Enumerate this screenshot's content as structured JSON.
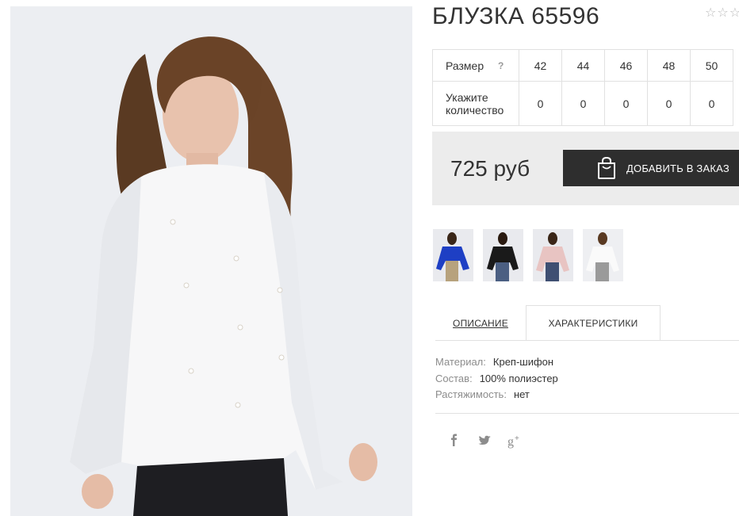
{
  "product": {
    "title": "БЛУЗКА 65596",
    "rating_stars_empty": 3,
    "photo_alt_icon": "product-photo-white-blouse"
  },
  "sizes": {
    "header_label": "Размер",
    "help_icon": "?",
    "values": [
      "42",
      "44",
      "46",
      "48",
      "50"
    ],
    "qty_label": "Укажите количество",
    "quantities": [
      "0",
      "0",
      "0",
      "0",
      "0"
    ]
  },
  "purchase": {
    "price": "725 руб",
    "add_button": "ДОБАВИТЬ В ЗАКАЗ",
    "button_color": "#2e2e2e",
    "bag_icon": "shopping-bag-icon"
  },
  "thumbnails": [
    {
      "color_name": "blue",
      "color": "#1e3fc4"
    },
    {
      "color_name": "black",
      "color": "#1a1a1a"
    },
    {
      "color_name": "pink",
      "color": "#e8c4c2"
    },
    {
      "color_name": "white",
      "color": "#f3f3f3"
    }
  ],
  "tabs": {
    "description": "ОПИСАНИЕ",
    "characteristics": "ХАРАКТЕРИСТИКИ",
    "active": "characteristics"
  },
  "specs": [
    {
      "key": "Материал:",
      "value": "Креп-шифон"
    },
    {
      "key": "Состав:",
      "value": "100% полиэстер"
    },
    {
      "key": "Растяжимость:",
      "value": "нет"
    }
  ],
  "social": {
    "facebook": "f",
    "twitter": "twitter-icon",
    "gplus": "g+"
  }
}
